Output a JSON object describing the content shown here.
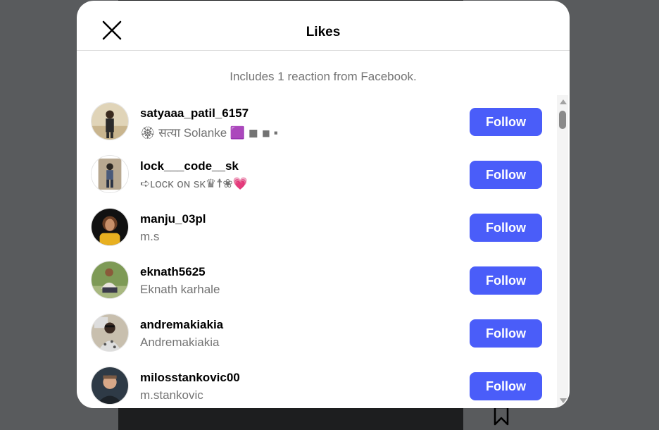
{
  "modal": {
    "title": "Likes",
    "note": "Includes 1 reaction from Facebook."
  },
  "users": [
    {
      "username": "satyaaa_patil_6157",
      "fullname": "🏵 सत्या Solanke 🟪 ◼ ◾ ▪",
      "button": "Follow",
      "avatar_bg": "#d9cfb8"
    },
    {
      "username": "lock___code__sk",
      "fullname": "➪ʟᴏᴄᴋ ᴏɴ sᴋ♛☨❀💗",
      "button": "Follow",
      "avatar_bg": "#c8b8a0"
    },
    {
      "username": "manju_03pl",
      "fullname": "m.s",
      "button": "Follow",
      "avatar_bg": "#7a5a3a"
    },
    {
      "username": "eknath5625",
      "fullname": "Eknath karhale",
      "button": "Follow",
      "avatar_bg": "#8aa060"
    },
    {
      "username": "andremakiakia",
      "fullname": "Andremakiakia",
      "button": "Follow",
      "avatar_bg": "#b0a898"
    },
    {
      "username": "milosstankovic00",
      "fullname": "m.stankovic",
      "button": "Follow",
      "avatar_bg": "#3a4a5a"
    }
  ],
  "colors": {
    "accent": "#4a5df9",
    "muted_text": "#737373"
  }
}
